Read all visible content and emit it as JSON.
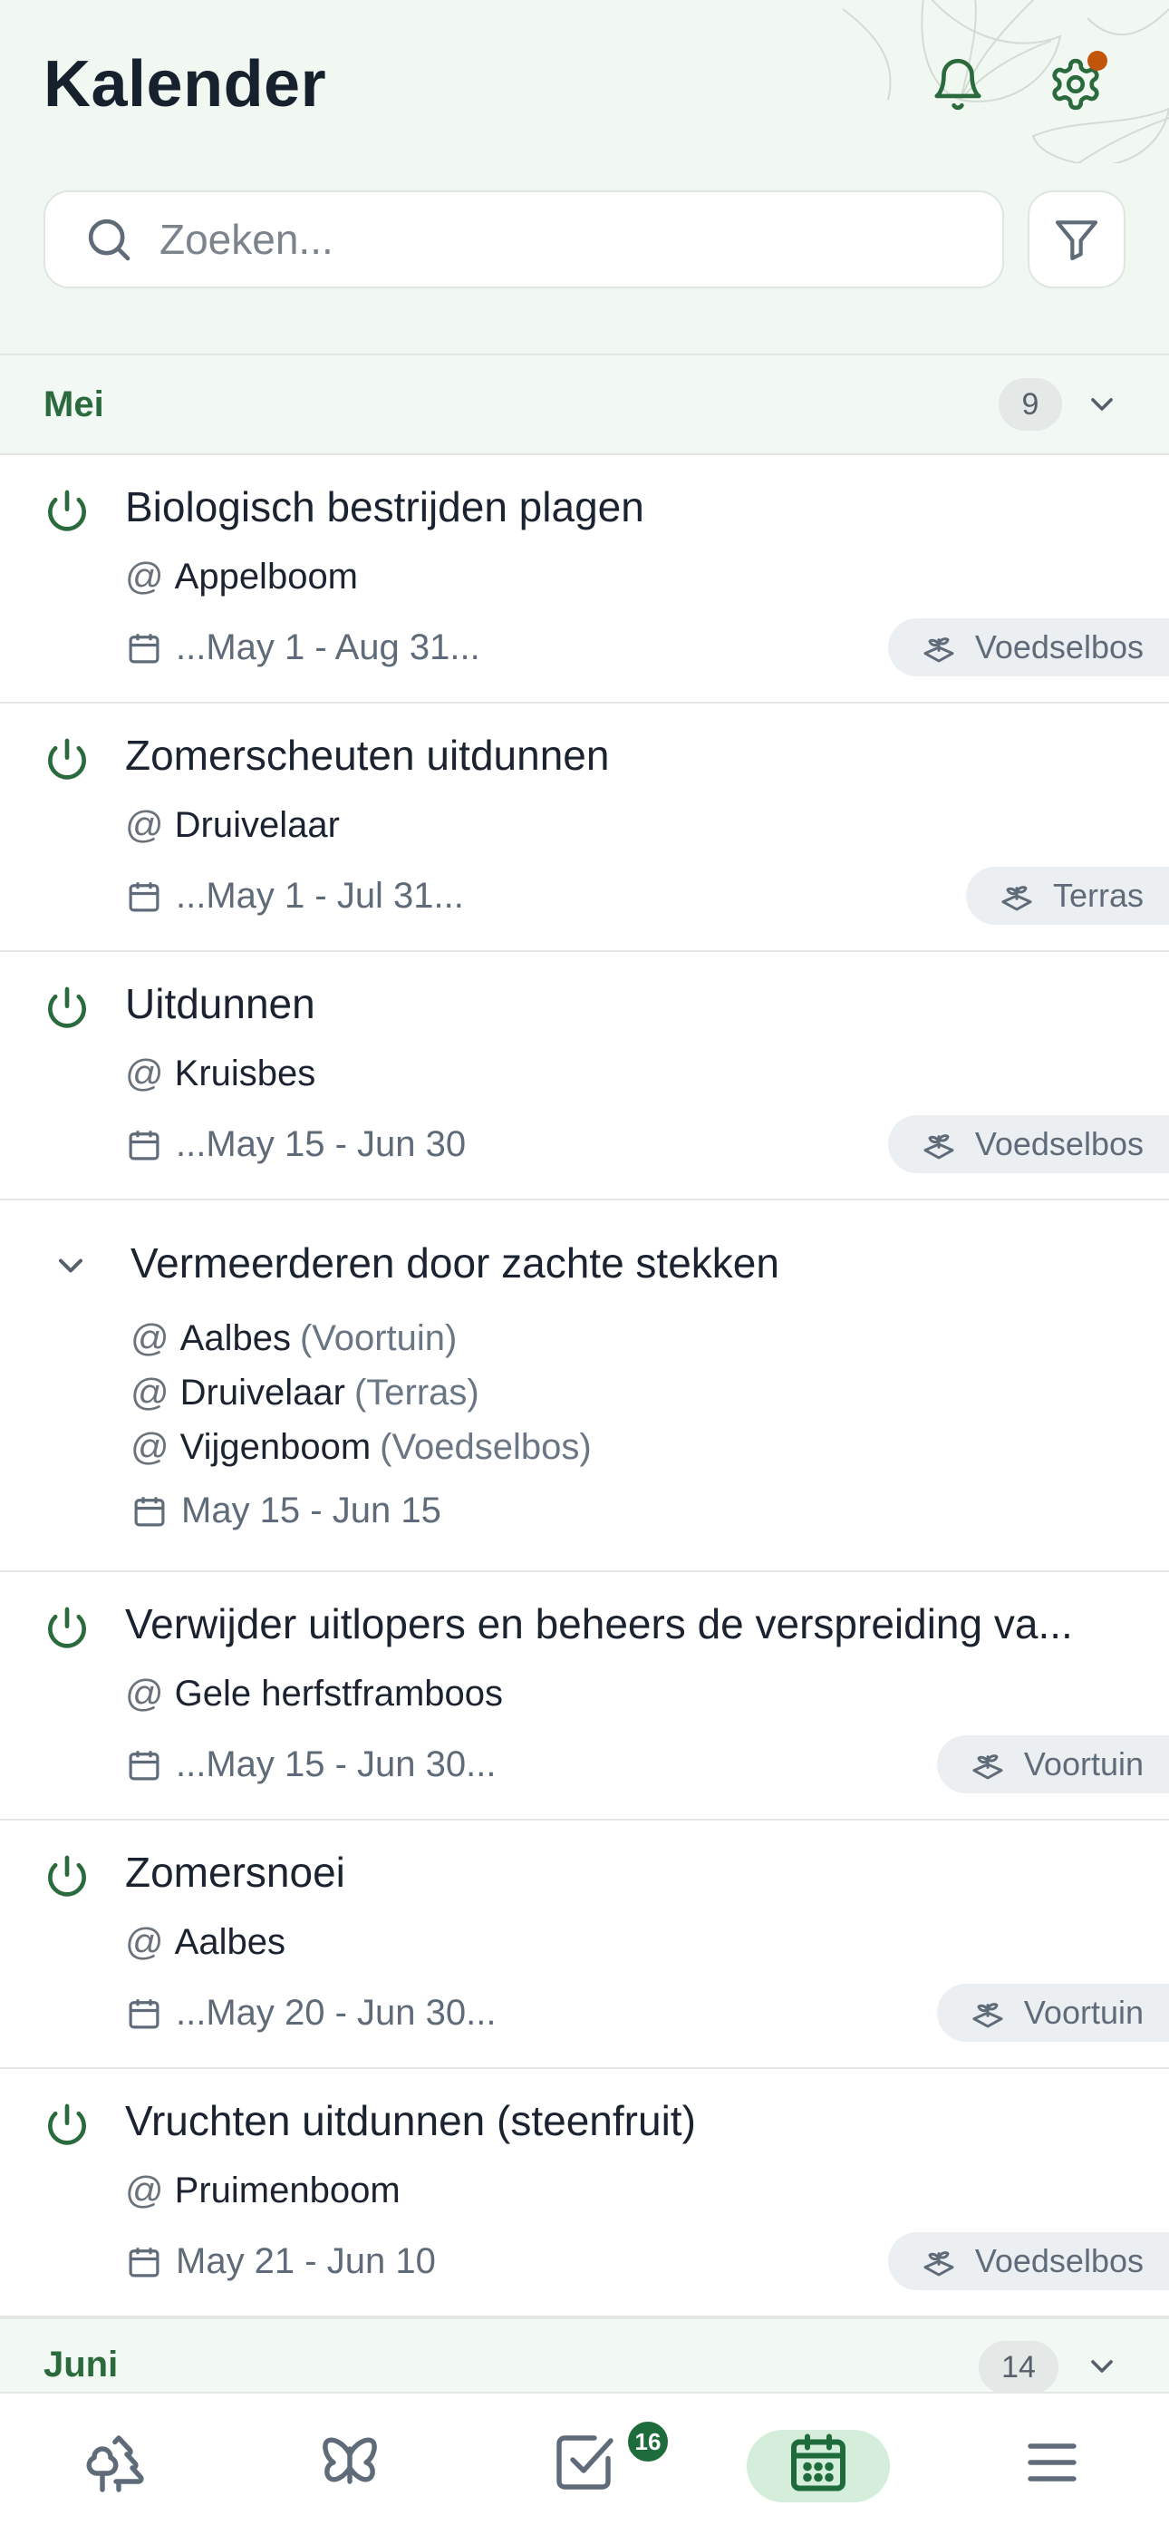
{
  "header": {
    "title": "Kalender",
    "notification_icon": "bell-icon",
    "settings_icon": "gear-icon",
    "settings_has_alert": true
  },
  "search": {
    "placeholder": "Zoeken...",
    "value": "",
    "filter_icon": "funnel-icon"
  },
  "colors": {
    "accent_green": "#2a6a3c",
    "header_bg": "#f1f8f2",
    "alert_orange": "#c2550c",
    "chip_bg": "#eceff1",
    "nav_active_bg": "#d4eedb"
  },
  "sections": [
    {
      "name": "Mei",
      "count": "9",
      "tasks": [
        {
          "title": "Biologisch bestrijden plagen",
          "plant": "Appelboom",
          "date": "...May 1 - Aug 31...",
          "location": "Voedselbos"
        },
        {
          "title": "Zomerscheuten uitdunnen",
          "plant": "Druivelaar",
          "date": "...May 1 - Jul 31...",
          "location": "Terras"
        },
        {
          "title": "Uitdunnen",
          "plant": "Kruisbes",
          "date": "...May 15 - Jun 30",
          "location": "Voedselbos"
        },
        {
          "title": "Vermeerderen door zachte stekken",
          "expanded": true,
          "plants": [
            {
              "name": "Aalbes",
              "location": "(Voortuin)"
            },
            {
              "name": "Druivelaar",
              "location": "(Terras)"
            },
            {
              "name": "Vijgenboom",
              "location": "(Voedselbos)"
            }
          ],
          "date": "May 15 - Jun 15"
        },
        {
          "title": "Verwijder uitlopers en beheers de verspreiding va...",
          "plant": "Gele herfstframboos",
          "date": "...May 15 - Jun 30...",
          "location": "Voortuin"
        },
        {
          "title": "Zomersnoei",
          "plant": "Aalbes",
          "date": "...May 20 - Jun 30...",
          "location": "Voortuin"
        },
        {
          "title": "Vruchten uitdunnen (steenfruit)",
          "plant": "Pruimenboom",
          "date": "May 21 - Jun 10",
          "location": "Voedselbos"
        }
      ]
    },
    {
      "name": "Juni",
      "count": "14"
    }
  ],
  "at_symbol": "@",
  "bottom_nav": {
    "items": [
      {
        "icon": "trees-icon",
        "active": false
      },
      {
        "icon": "butterfly-icon",
        "active": false
      },
      {
        "icon": "tasks-checkbox-icon",
        "active": false,
        "badge": "16"
      },
      {
        "icon": "calendar-icon",
        "active": true
      },
      {
        "icon": "menu-icon",
        "active": false
      }
    ]
  }
}
